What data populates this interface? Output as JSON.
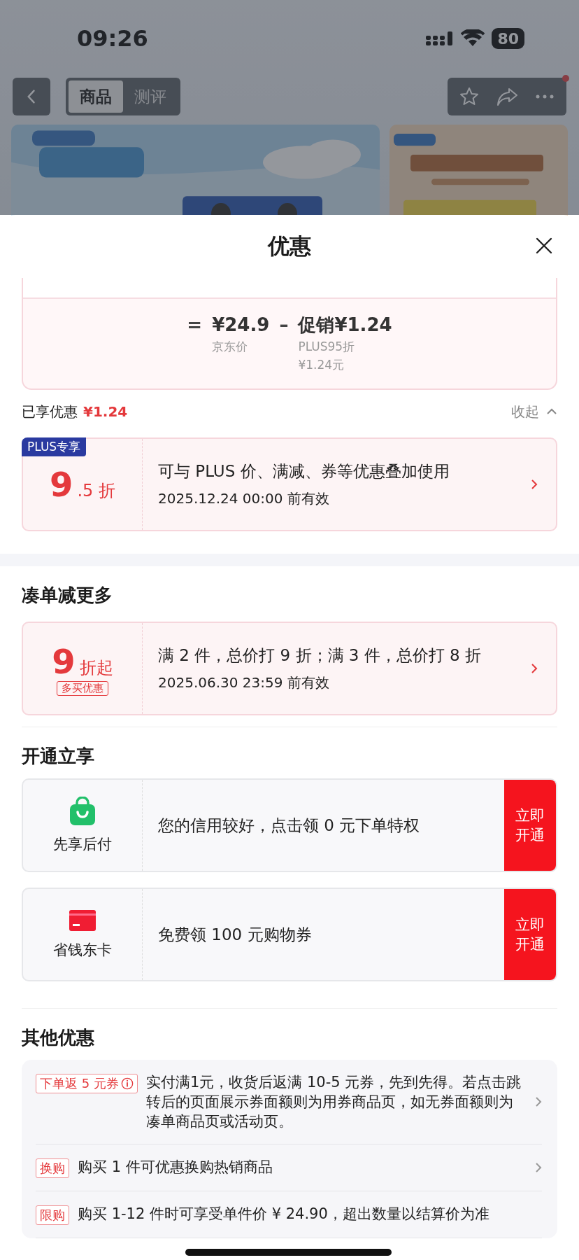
{
  "status_bar": {
    "time": "09:26",
    "battery": "80"
  },
  "nav": {
    "tabs": [
      {
        "label": "商品",
        "selected": true
      },
      {
        "label": "测评",
        "selected": false
      }
    ],
    "notification_dot": true
  },
  "sheet": {
    "title": "优惠",
    "price_breakdown": [
      {
        "kind": "operator",
        "symbol": "="
      },
      {
        "kind": "term",
        "value": "¥24.9",
        "labels": [
          "京东价"
        ]
      },
      {
        "kind": "operator",
        "symbol": "–"
      },
      {
        "kind": "term",
        "value": "促销¥1.24",
        "labels": [
          "PLUS95折",
          "¥1.24元"
        ]
      }
    ],
    "applied": {
      "label": "已享优惠",
      "amount": "¥1.24",
      "toggle": "收起",
      "expanded": true
    },
    "applied_offers": [
      {
        "badge": "PLUS专享",
        "discount_major": "9",
        "discount_minor": ".5 折",
        "description": "可与 PLUS 价、满减、券等优惠叠加使用",
        "validity": "2025.12.24 00:00 前有效"
      }
    ],
    "sections": [
      {
        "title": "凑单减更多",
        "kind": "deal",
        "items": [
          {
            "discount_major": "9",
            "discount_minor": "折起",
            "tag": "多买优惠",
            "description": "满 2 件，总价打 9 折；满 3 件，总价打 8 折",
            "validity": "2025.06.30 23:59 前有效"
          }
        ]
      },
      {
        "title": "开通立享",
        "kind": "service",
        "items": [
          {
            "name": "先享后付",
            "description": "您的信用较好，点击领 0 元下单特权",
            "action": "立即开通"
          },
          {
            "name": "省钱东卡",
            "description": "免费领 100 元购物券",
            "action": "立即开通"
          }
        ]
      },
      {
        "title": "其他优惠",
        "kind": "other",
        "items": [
          {
            "tag": "下单返 5 元券",
            "info": true,
            "text": "实付满1元，收货后返满 10-5 元券，先到先得。若点击跳转后的页面展示券面额则为用券商品页，如无券面额则为凑单商品页或活动页。",
            "chevron": true
          },
          {
            "tag": "换购",
            "info": false,
            "text": "购买 1 件可优惠换购热销商品",
            "chevron": true
          },
          {
            "tag": "限购",
            "info": false,
            "text": "购买 1-12 件时可享受单件价 ¥ 24.90，超出数量以结算价为准",
            "chevron": false
          }
        ]
      }
    ]
  }
}
